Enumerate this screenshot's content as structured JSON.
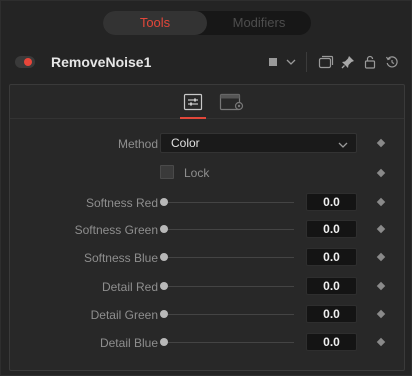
{
  "tabs": {
    "tools": "Tools",
    "modifiers": "Modifiers"
  },
  "colors": {
    "accent": "#e2473a",
    "node_dot": "#e8463a"
  },
  "node": {
    "name": "RemoveNoise1"
  },
  "header_icons": [
    "color-swatch-icon",
    "chevron-down-icon",
    "version-icon",
    "pin-icon",
    "lock-icon",
    "reset-icon"
  ],
  "subtab_icons": [
    "controls-icon",
    "settings-icon"
  ],
  "controls": {
    "method": {
      "label": "Method",
      "value": "Color"
    },
    "lock": {
      "label": "Lock",
      "checked": false
    },
    "sliders": [
      {
        "label": "Softness Red",
        "value": "0.0"
      },
      {
        "label": "Softness Green",
        "value": "0.0"
      },
      {
        "label": "Softness Blue",
        "value": "0.0"
      },
      {
        "label": "Detail Red",
        "value": "0.0"
      },
      {
        "label": "Detail Green",
        "value": "0.0"
      },
      {
        "label": "Detail Blue",
        "value": "0.0"
      }
    ]
  }
}
